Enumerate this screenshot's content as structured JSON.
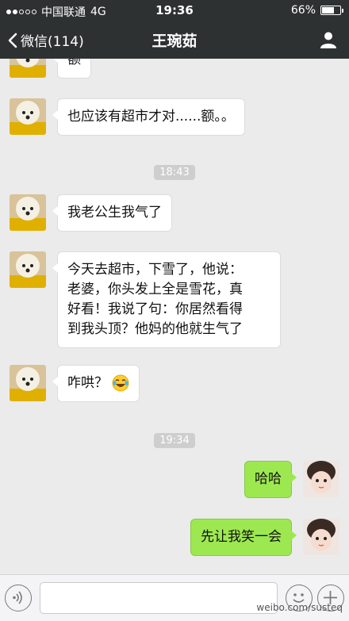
{
  "status_bar": {
    "carrier": "中国联通",
    "network": "4G",
    "time": "19:36",
    "battery": "66%",
    "battery_level": 0.66
  },
  "nav": {
    "back_label": "微信(114)",
    "title": "王琬茹"
  },
  "messages": [
    {
      "side": "left",
      "text": "额"
    },
    {
      "side": "left",
      "text": "也应该有超市才对......额。。"
    },
    {
      "type": "time",
      "text": "18:43"
    },
    {
      "side": "left",
      "text": "我老公生我气了"
    },
    {
      "side": "left",
      "lines": [
        "今天去超市，下雪了，他说：",
        "老婆，你头发上全是雪花，真",
        "好看！我说了句：你居然看得",
        "到我头顶？他妈的他就生气了"
      ]
    },
    {
      "side": "left",
      "text": "咋哄？",
      "emoji": "laughing-crying-emoji"
    },
    {
      "type": "time",
      "text": "19:34"
    },
    {
      "side": "right",
      "text": "哈哈"
    },
    {
      "side": "right",
      "text": "先让我笑一会"
    }
  ],
  "input_bar": {
    "placeholder": ""
  },
  "watermark": "weibo.com/susteq",
  "icons": {
    "back": "chevron-left-icon",
    "user": "user-profile-icon",
    "voice": "voice-icon",
    "emoji": "emoji-icon",
    "plus": "plus-icon"
  },
  "colors": {
    "navbar": "#2e3132",
    "chat_bg": "#ebebeb",
    "bubble_left": "#ffffff",
    "bubble_right": "#9de850"
  }
}
